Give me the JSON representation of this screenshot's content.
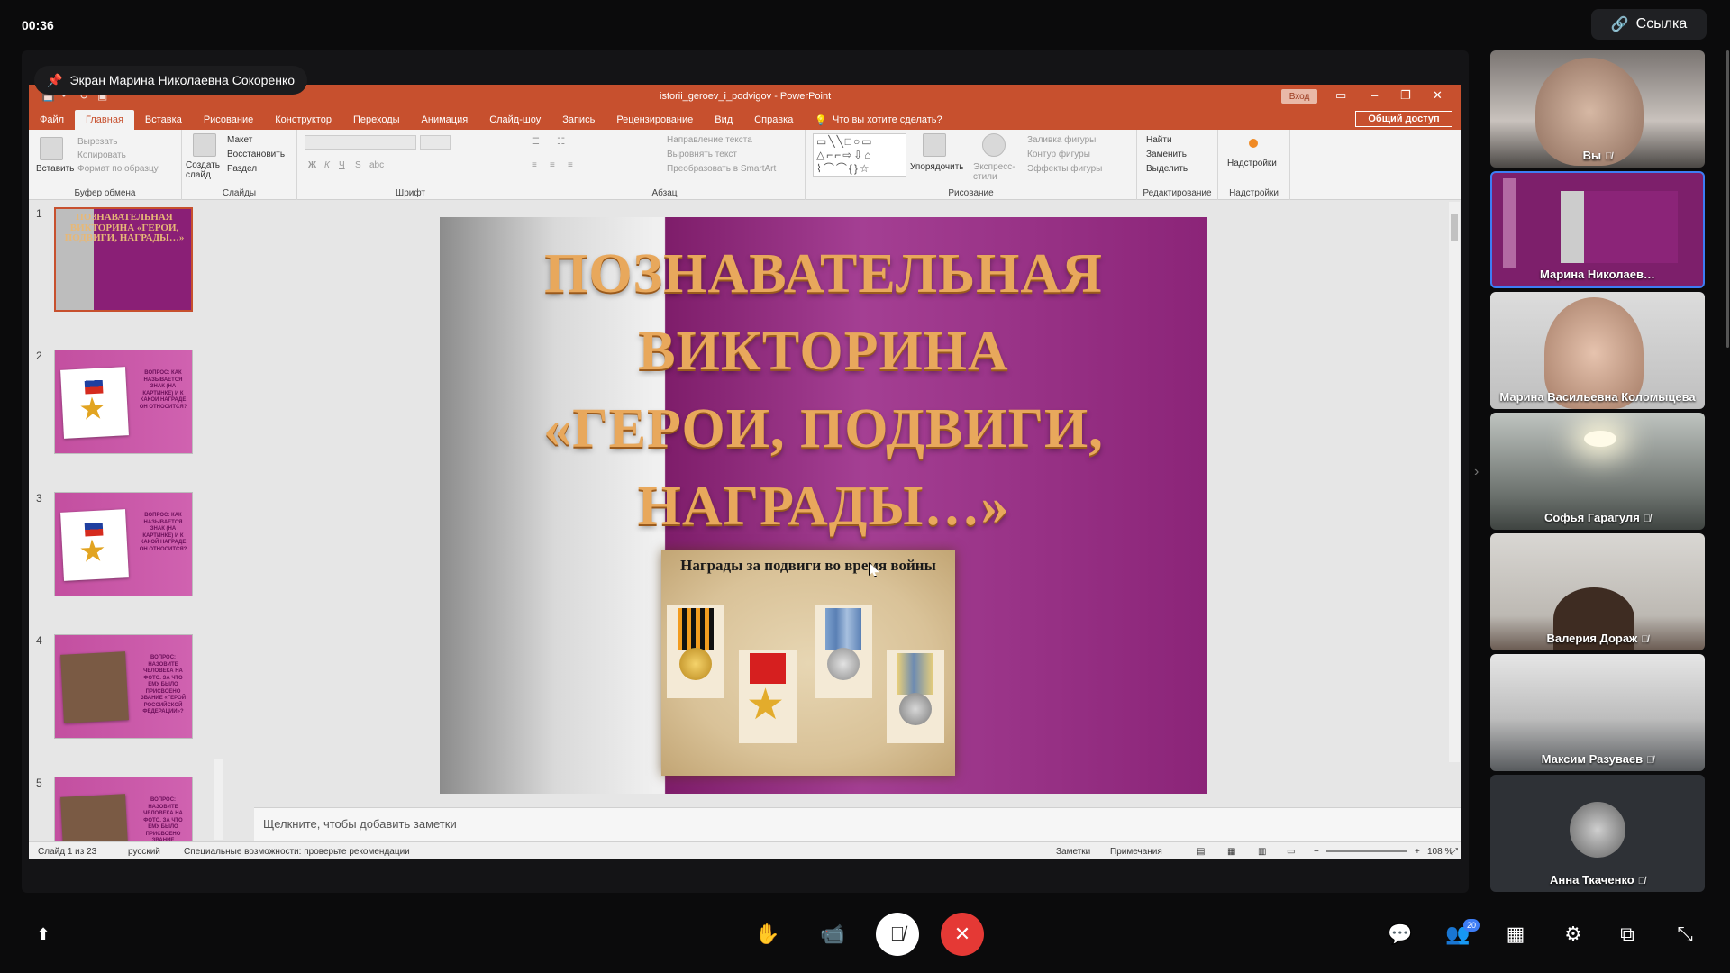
{
  "meeting": {
    "timer": "00:36",
    "link_button": "Ссылка",
    "share_label": "Экран Марина Николаевна Сокоренко"
  },
  "ppt": {
    "window_title": "istorii_geroev_i_podvigov - PowerPoint",
    "login_button": "Вход",
    "share_access": "Общий доступ",
    "tabs": [
      "Файл",
      "Главная",
      "Вставка",
      "Рисование",
      "Конструктор",
      "Переходы",
      "Анимация",
      "Слайд-шоу",
      "Запись",
      "Рецензирование",
      "Вид",
      "Справка",
      "Что вы хотите сделать?"
    ],
    "ribbon": {
      "paste": "Вставить",
      "cut": "Вырезать",
      "copy": "Копировать",
      "format_painter": "Формат по образцу",
      "clipboard_label": "Буфер обмена",
      "new_slide": "Создать слайд",
      "layout": "Макет",
      "reset": "Восстановить",
      "section": "Раздел",
      "slides_label": "Слайды",
      "font_label": "Шрифт",
      "text_direction": "Направление текста",
      "align_text": "Выровнять текст",
      "smartart": "Преобразовать в SmartArt",
      "paragraph_label": "Абзац",
      "arrange": "Упорядочить",
      "quick_styles": "Экспресс-стили",
      "shape_fill": "Заливка фигуры",
      "shape_outline": "Контур фигуры",
      "shape_effects": "Эффекты фигуры",
      "drawing_label": "Рисование",
      "find": "Найти",
      "replace": "Заменить",
      "select": "Выделить",
      "editing_label": "Редактирование",
      "addins": "Надстройки",
      "addins_label": "Надстройки"
    },
    "thumbnails": [
      {
        "num": "1",
        "title": "ПОЗНАВАТЕЛЬНАЯ ВИКТОРИНА «ГЕРОИ, ПОДВИГИ, НАГРАДЫ…»"
      },
      {
        "num": "2",
        "text": "ВОПРОС: КАК НАЗЫВАЕТСЯ ЗНАК (НА КАРТИНКЕ) И К КАКОЙ НАГРАДЕ ОН ОТНОСИТСЯ?"
      },
      {
        "num": "3",
        "text": "ВОПРОС: КАК НАЗЫВАЕТСЯ ЗНАК (НА КАРТИНКЕ) И К КАКОЙ НАГРАДЕ ОН ОТНОСИТСЯ?"
      },
      {
        "num": "4",
        "text": "ВОПРОС: НАЗОВИТЕ ЧЕЛОВЕКА НА ФОТО. ЗА ЧТО ЕМУ БЫЛО ПРИСВОЕНО ЗВАНИЕ «ГЕРОЙ РОССИЙСКОЙ ФЕДЕРАЦИИ»?"
      },
      {
        "num": "5",
        "text": "ВОПРОС: НАЗОВИТЕ ЧЕЛОВЕКА НА ФОТО. ЗА ЧТО ЕМУ БЫЛО ПРИСВОЕНО ЗВАНИЕ"
      }
    ],
    "slide": {
      "title_lines": [
        "ПОЗНАВАТЕЛЬНАЯ",
        "ВИКТОРИНА",
        "«ГЕРОИ, ПОДВИГИ,",
        "НАГРАДЫ…»"
      ],
      "awards_caption": "Награды за подвиги во время войны"
    },
    "notes_placeholder": "Щелкните, чтобы добавить заметки",
    "status": {
      "slide_counter": "Слайд 1 из 23",
      "language": "русский",
      "accessibility": "Специальные возможности: проверьте рекомендации",
      "notes": "Заметки",
      "comments": "Примечания",
      "zoom": "108 %"
    }
  },
  "participants": [
    {
      "name": "Вы",
      "muted": true
    },
    {
      "name": "Марина Николаев…",
      "muted": false
    },
    {
      "name": "Марина Васильевна Коломыцева",
      "muted": false
    },
    {
      "name": "Софья Гарагуля",
      "muted": true
    },
    {
      "name": "Валерия Дораж",
      "muted": true
    },
    {
      "name": "Максим Разуваев",
      "muted": true
    },
    {
      "name": "Анна Ткаченко",
      "muted": true
    }
  ],
  "controls": {
    "participants_count": "20"
  },
  "colors": {
    "ppt_accent": "#c7502e",
    "end_call": "#e53935",
    "badge": "#3d7df5"
  }
}
